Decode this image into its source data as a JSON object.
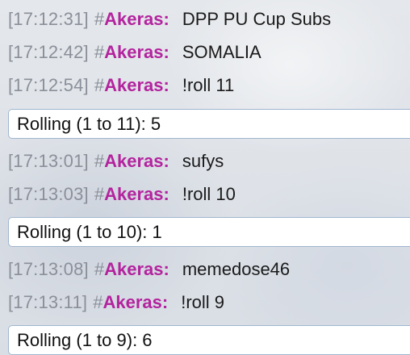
{
  "chat": {
    "groups": [
      {
        "lines": [
          {
            "timestamp": "[17:12:31]",
            "hash": "#",
            "user": "Akeras:",
            "message": "DPP PU Cup Subs"
          },
          {
            "timestamp": "[17:12:42]",
            "hash": "#",
            "user": "Akeras:",
            "message": "SOMALIA"
          },
          {
            "timestamp": "[17:12:54]",
            "hash": "#",
            "user": "Akeras:",
            "message": "!roll 11"
          }
        ],
        "roll_result": "Rolling (1 to 11): 5"
      },
      {
        "lines": [
          {
            "timestamp": "[17:13:01]",
            "hash": "#",
            "user": "Akeras:",
            "message": "sufys"
          },
          {
            "timestamp": "[17:13:03]",
            "hash": "#",
            "user": "Akeras:",
            "message": "!roll 10"
          }
        ],
        "roll_result": "Rolling (1 to 10): 1"
      },
      {
        "lines": [
          {
            "timestamp": "[17:13:08]",
            "hash": "#",
            "user": "Akeras:",
            "message": "memedose46"
          },
          {
            "timestamp": "[17:13:11]",
            "hash": "#",
            "user": "Akeras:",
            "message": "!roll 9"
          }
        ],
        "roll_result": "Rolling (1 to 9): 6"
      }
    ]
  },
  "colors": {
    "username": "#b3239e",
    "timestamp": "#8a8f99",
    "roll_box_border": "#9fb6d0"
  }
}
